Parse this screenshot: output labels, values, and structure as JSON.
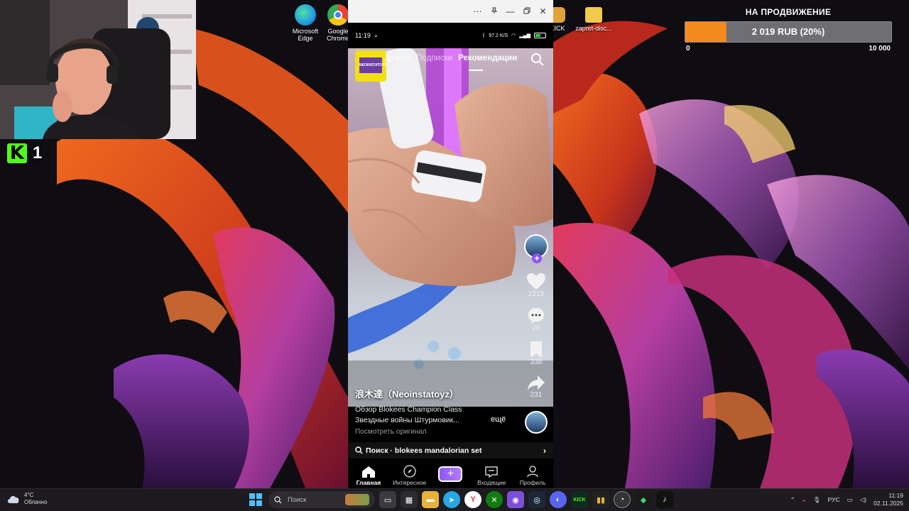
{
  "desktop": {
    "icons": [
      {
        "label": "Microsoft Edge",
        "icon": "edge-icon",
        "color": "#1f9be3"
      },
      {
        "label": "Google Chrome",
        "icon": "chrome-icon",
        "color": "#e7452f"
      },
      {
        "label": "KICK",
        "icon": "kick-folder-icon",
        "color": "#e2a23a"
      },
      {
        "label": "zapret-disc...",
        "icon": "folder-icon",
        "color": "#f2c94c"
      }
    ]
  },
  "stream_overlay": {
    "kick_viewers": "1",
    "donation": {
      "title": "НА ПРОДВИЖЕНИЕ",
      "value_text": "2 019 RUB (20%)",
      "progress_percent": 20,
      "min_label": "0",
      "max_label": "10 000",
      "fill_color": "#f58a1f"
    }
  },
  "phone_window": {
    "status": {
      "time": "11:19",
      "network": "97.2 K/S",
      "battery_level": 0.55
    },
    "feed_tabs": [
      {
        "label": "Друзья",
        "active": false
      },
      {
        "label": "Подписки",
        "active": false
      },
      {
        "label": "Рекомендации",
        "active": true
      }
    ],
    "channel_logo_text": "NEOINSTATOYZ",
    "rail": {
      "likes": "2215",
      "comments": "28",
      "saves": "338",
      "shares": "231"
    },
    "author": "浪木達（Neoinstatoyz）",
    "caption_line1": "Обзор Blokees Champion Class",
    "caption_line2": "Звездные войны Штурмовик...",
    "caption_more": "ещё",
    "caption_link": "Посмотреть оригинал",
    "search_suggestion": "Поиск · blokees mandalorian set",
    "bottom_nav": [
      {
        "label": "Главная",
        "icon": "home-icon",
        "active": true
      },
      {
        "label": "Интересное",
        "icon": "compass-icon",
        "active": false
      },
      {
        "label": "",
        "icon": "create-plus-icon",
        "active": false
      },
      {
        "label": "Входящие",
        "icon": "inbox-icon",
        "active": false
      },
      {
        "label": "Профиль",
        "icon": "profile-icon",
        "active": false
      }
    ]
  },
  "taskbar": {
    "weather_temp": "4°C",
    "weather_desc": "Облачно",
    "search_placeholder": "Поиск",
    "language": "РУС",
    "time": "11:19",
    "date": "02.11.2025"
  }
}
